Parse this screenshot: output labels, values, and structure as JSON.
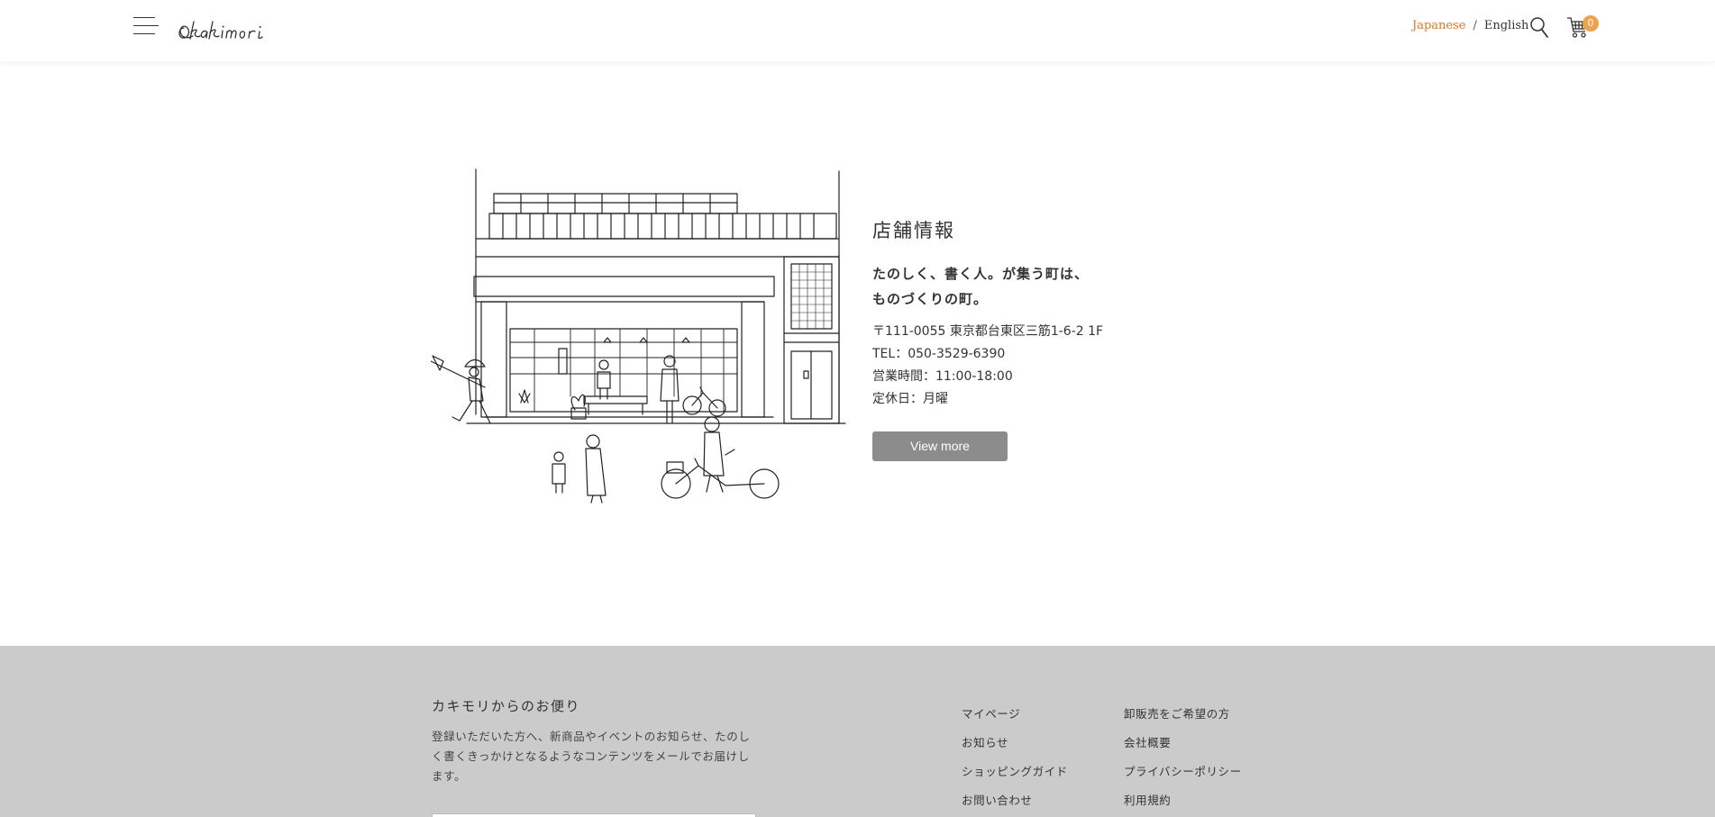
{
  "header": {
    "lang_japanese": "Japanese",
    "lang_separator": "/",
    "lang_english": "English",
    "cart_count": "0",
    "accent_color": "#e87722",
    "badge_color": "#f0a24a",
    "icons": [
      "hamburger-menu-icon",
      "search-icon",
      "cart-icon"
    ]
  },
  "store": {
    "title": "店舗情報",
    "catch_line1": "たのしく、書く人。が集う町は、",
    "catch_line2": "ものづくりの町。",
    "address": "〒111-0055 東京都台東区三筋1-6-2 1F",
    "tel": "TEL：050-3529-6390",
    "hours": "営業時間：11:00-18:00",
    "closed": "定休日：月曜",
    "view_more": "View more",
    "button_color": "#8c8c8c"
  },
  "footer": {
    "background_color": "#cbcbcb",
    "newsletter_title": "カキモリからのお便り",
    "newsletter_desc": "登録いただいた方へ、新商品やイベントのお知らせ、たのしく書くきっかけとなるようなコンテンツをメールでお届けします。",
    "nav_col1": [
      "マイページ",
      "お知らせ",
      "ショッピングガイド",
      "お問い合わせ"
    ],
    "nav_col2": [
      "卸販売をご希望の方",
      "会社概要",
      "プライバシーポリシー",
      "利用規約"
    ]
  }
}
